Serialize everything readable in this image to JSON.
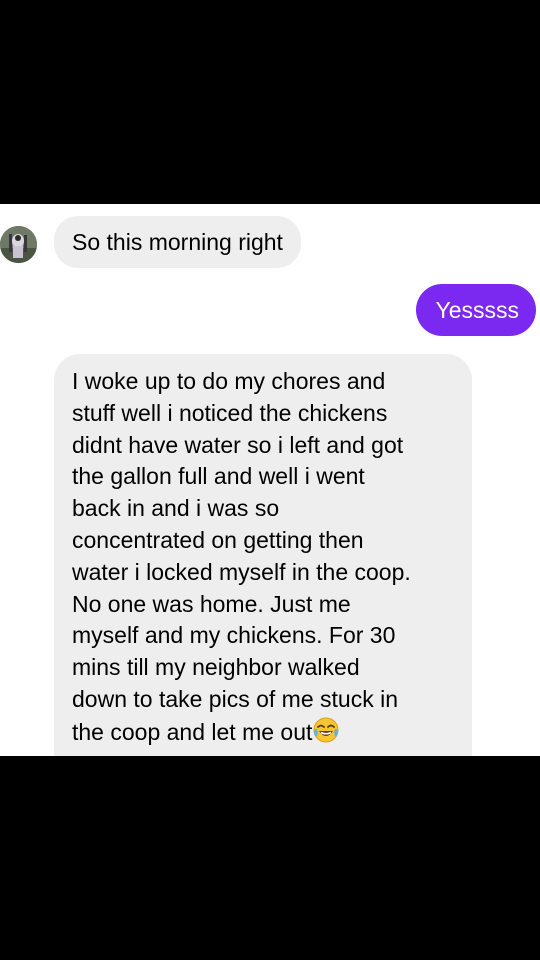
{
  "conversation": {
    "messages": [
      {
        "sender": "contact",
        "text": "So this morning right"
      },
      {
        "sender": "me",
        "text": "Yesssss"
      },
      {
        "sender": "contact",
        "lines": [
          "I woke up to do my chores and",
          "stuff well i noticed the chickens",
          "didnt have water so i left and got",
          "the gallon full and well i went",
          "back in and i was so",
          "concentrated on getting then",
          "water i locked myself in the coop.",
          "No one was home. Just me",
          "myself and my chickens. For 30",
          "mins till my neighbor walked",
          "down to take pics of me stuck in",
          "the coop and let me out"
        ],
        "emoji": "face-with-tears-of-joy-icon"
      }
    ]
  },
  "colors": {
    "incoming_bubble": "#eeeeef",
    "outgoing_bubble": "#7b29f0",
    "letterbox": "#000000"
  }
}
